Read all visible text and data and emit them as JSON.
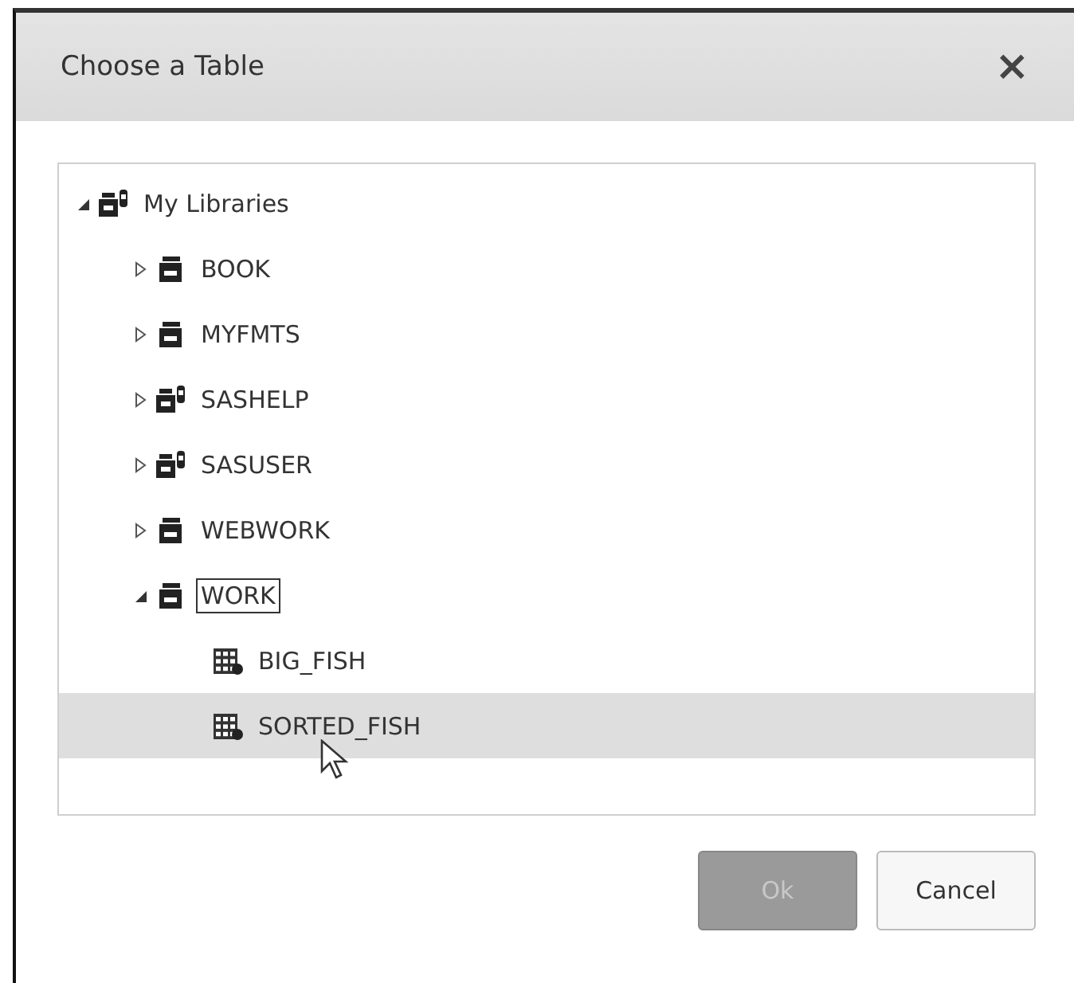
{
  "dialog": {
    "title": "Choose a Table",
    "close": "×"
  },
  "tree": [
    {
      "label": "My Libraries",
      "kind": "library-group",
      "expanded": true,
      "selected": false,
      "focused": false,
      "children": [
        {
          "label": "BOOK",
          "kind": "library",
          "expanded": false,
          "selected": false,
          "focused": false
        },
        {
          "label": "MYFMTS",
          "kind": "library",
          "expanded": false,
          "selected": false,
          "focused": false
        },
        {
          "label": "SASHELP",
          "kind": "library-group",
          "expanded": false,
          "selected": false,
          "focused": false
        },
        {
          "label": "SASUSER",
          "kind": "library-group",
          "expanded": false,
          "selected": false,
          "focused": false
        },
        {
          "label": "WEBWORK",
          "kind": "library",
          "expanded": false,
          "selected": false,
          "focused": false
        },
        {
          "label": "WORK",
          "kind": "library",
          "expanded": true,
          "selected": false,
          "focused": true,
          "children": [
            {
              "label": "BIG_FISH",
              "kind": "table",
              "selected": false,
              "focused": false
            },
            {
              "label": "SORTED_FISH",
              "kind": "table",
              "selected": true,
              "focused": false
            }
          ]
        }
      ]
    }
  ],
  "buttons": [
    {
      "label": "Ok",
      "disabled": true
    },
    {
      "label": "Cancel",
      "disabled": false
    }
  ]
}
